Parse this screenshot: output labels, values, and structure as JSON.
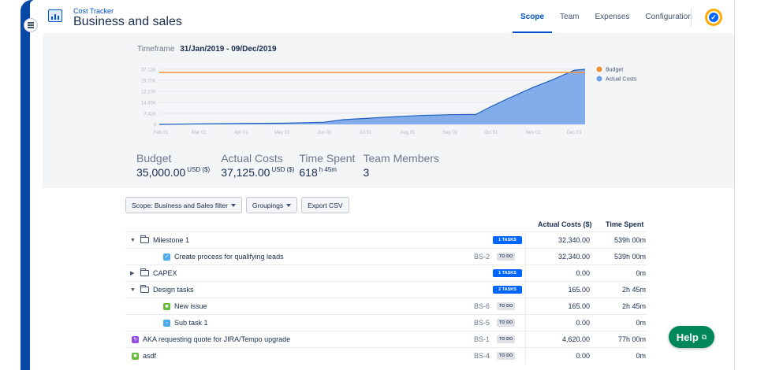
{
  "app": {
    "name": "Cost Tracker",
    "title": "Business and sales"
  },
  "nav": {
    "tabs": [
      {
        "label": "Scope",
        "active": true
      },
      {
        "label": "Team",
        "active": false
      },
      {
        "label": "Expenses",
        "active": false
      },
      {
        "label": "Configuration",
        "active": false
      }
    ]
  },
  "summary": {
    "timeframe_label": "Timeframe",
    "timeframe_value": "31/Jan/2019  -  09/Dec/2019",
    "stats": {
      "budget_label": "Budget",
      "budget_value": "35,000.00",
      "budget_unit": "USD ($)",
      "actual_label": "Actual Costs",
      "actual_value": "37,125.00",
      "actual_unit": "USD ($)",
      "time_label": "Time Spent",
      "time_value": "618",
      "time_unit": "h 45m",
      "team_label": "Team Members",
      "team_value": "3"
    }
  },
  "chart_data": {
    "type": "area",
    "x_ticks": [
      "Feb 01",
      "Mar 01",
      "Apr 01",
      "May 01",
      "Jun 01",
      "Jul 01",
      "Aug 01",
      "Sep 01",
      "Oct 01",
      "Nov 01",
      "Dec 01"
    ],
    "y_ticks": [
      "0",
      "7.42K",
      "14.85K",
      "22.27K",
      "29.70K",
      "37.13K"
    ],
    "ylim": [
      0,
      37130
    ],
    "legend": [
      "Budget",
      "Actual Costs"
    ],
    "legend_position": "right",
    "colors": {
      "budget": "#f79233",
      "actual": "#6fa0e8",
      "actual_line": "#1f5fbf"
    },
    "budget": 35000,
    "actual_series": [
      {
        "x": "2019-01-31",
        "y": 0
      },
      {
        "x": "2019-03-01",
        "y": 300
      },
      {
        "x": "2019-04-01",
        "y": 600
      },
      {
        "x": "2019-05-01",
        "y": 800
      },
      {
        "x": "2019-06-01",
        "y": 1500
      },
      {
        "x": "2019-06-15",
        "y": 3200
      },
      {
        "x": "2019-07-15",
        "y": 4800
      },
      {
        "x": "2019-08-10",
        "y": 6000
      },
      {
        "x": "2019-09-01",
        "y": 6500
      },
      {
        "x": "2019-09-20",
        "y": 6700
      },
      {
        "x": "2019-10-01",
        "y": 12000
      },
      {
        "x": "2019-10-15",
        "y": 18000
      },
      {
        "x": "2019-11-01",
        "y": 25000
      },
      {
        "x": "2019-11-15",
        "y": 30000
      },
      {
        "x": "2019-12-01",
        "y": 36500
      },
      {
        "x": "2019-12-09",
        "y": 37125
      }
    ]
  },
  "toolbar": {
    "scope_filter": "Scope: Business and Sales filter",
    "groupings": "Groupings",
    "export": "Export CSV"
  },
  "table": {
    "col_cost": "Actual Costs ($)",
    "col_time": "Time Spent",
    "rows": [
      {
        "type": "group",
        "expanded": true,
        "label": "Milestone 1",
        "badge": "1 TASKS",
        "cost": "32,340.00",
        "time": "539h 00m"
      },
      {
        "type": "issue",
        "icon": "task",
        "label": "Create process for qualifying leads",
        "key": "BS-2",
        "status": "TO DO",
        "cost": "32,340.00",
        "time": "539h 00m"
      },
      {
        "type": "group",
        "expanded": false,
        "label": "CAPEX",
        "badge": "1 TASKS",
        "cost": "0.00",
        "time": "0m"
      },
      {
        "type": "group",
        "expanded": true,
        "label": "Design tasks",
        "badge": "2 TASKS",
        "cost": "165.00",
        "time": "2h 45m"
      },
      {
        "type": "issue",
        "icon": "story",
        "label": "New issue",
        "key": "BS-6",
        "status": "TO DO",
        "cost": "165.00",
        "time": "2h 45m"
      },
      {
        "type": "issue",
        "icon": "subtask",
        "label": "Sub task 1",
        "key": "BS-5",
        "status": "TO DO",
        "cost": "0.00",
        "time": "0m"
      },
      {
        "type": "top",
        "icon": "epic",
        "label": "AKA requesting quote for JIRA/Tempo upgrade",
        "key": "BS-1",
        "status": "TO DO",
        "cost": "4,620.00",
        "time": "77h 00m"
      },
      {
        "type": "top",
        "icon": "story",
        "label": "asdf",
        "key": "BS-4",
        "status": "TO DO",
        "cost": "0.00",
        "time": "0m"
      }
    ]
  },
  "help": {
    "label": "Help"
  }
}
